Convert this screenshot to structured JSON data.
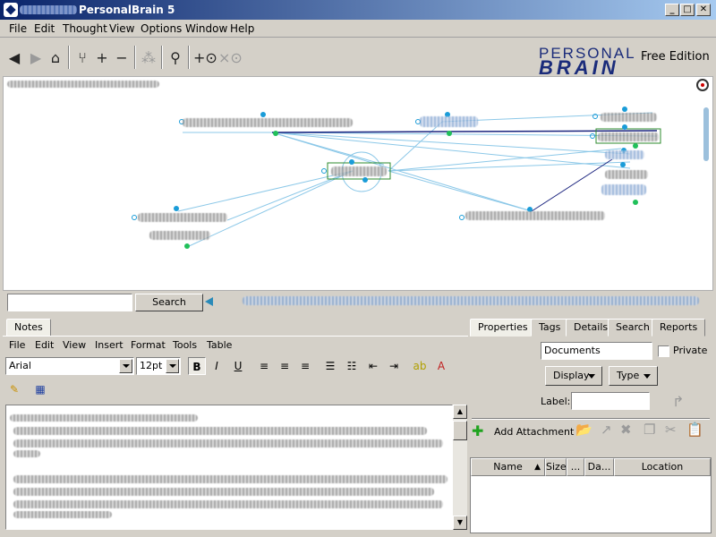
{
  "window": {
    "title": "PersonalBrain 5",
    "controls": [
      "minimize",
      "maximize",
      "close"
    ]
  },
  "menu": [
    "File",
    "Edit",
    "Thought",
    "View",
    "Options",
    "Window",
    "Help"
  ],
  "brand": {
    "line1": "PERSONAL",
    "line2": "BRAIN",
    "edition": "Free Edition"
  },
  "search": {
    "value": "",
    "button": "Search"
  },
  "notes": {
    "tab": "Notes",
    "menu": [
      "File",
      "Edit",
      "View",
      "Insert",
      "Format",
      "Tools",
      "Table"
    ],
    "font": "Arial",
    "size": "12pt"
  },
  "props": {
    "tabs": [
      "Properties",
      "Tags",
      "Details",
      "Search",
      "Reports"
    ],
    "type_value": "Documents",
    "private_label": "Private",
    "display_button": "Display",
    "type_button": "Type",
    "label_label": "Label:",
    "label_value": "",
    "add_attachment": "Add Attachment",
    "columns": [
      "Name",
      "Size",
      "...",
      "Da...",
      "Location"
    ]
  },
  "colors": {
    "title_gradient_start": "#0a246a",
    "link_light": "#8cc8e8",
    "link_dark": "#1a237e",
    "node_dot": "#1a9cd8",
    "node_dot_green": "#21c05a",
    "selection_green": "#2e8b2e",
    "brand_blue": "#1a2b7a"
  }
}
